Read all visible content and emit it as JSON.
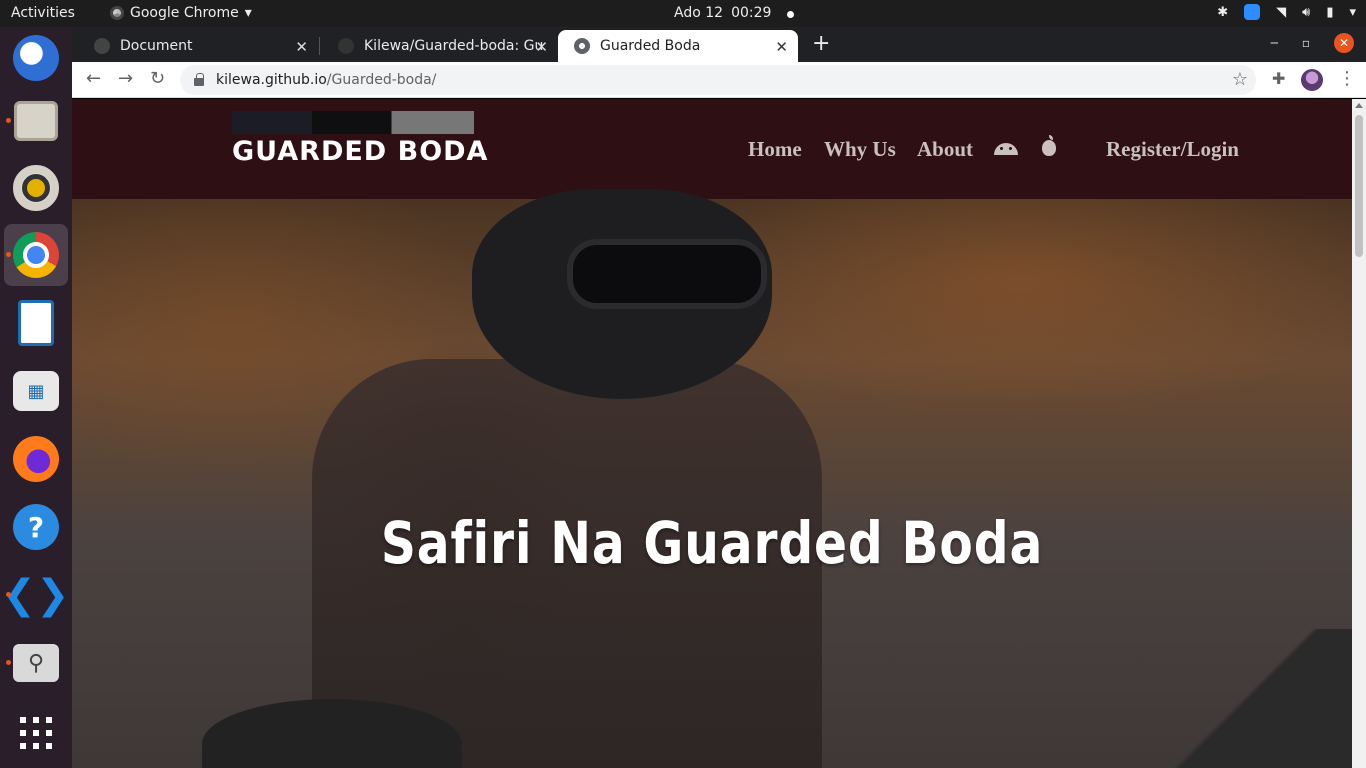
{
  "system": {
    "activities": "Activities",
    "app_name": "Google Chrome",
    "date": "Ado 12",
    "time": "00:29"
  },
  "dock": {
    "items": [
      {
        "name": "thunderbird-icon"
      },
      {
        "name": "files-icon"
      },
      {
        "name": "rhythmbox-icon"
      },
      {
        "name": "chrome-icon"
      },
      {
        "name": "libreoffice-writer-icon"
      },
      {
        "name": "software-store-icon"
      },
      {
        "name": "firefox-icon"
      },
      {
        "name": "help-icon"
      },
      {
        "name": "vscode-icon"
      },
      {
        "name": "screenshot-search-icon"
      }
    ]
  },
  "browser": {
    "tabs": [
      {
        "label": "Document"
      },
      {
        "label": "Kilewa/Guarded-boda: Gu"
      },
      {
        "label": "Guarded Boda"
      }
    ],
    "url_host": "kilewa.github.io",
    "url_path": "/Guarded-boda/"
  },
  "site": {
    "logo_text": "GUARDED BODA",
    "nav": {
      "home": "Home",
      "why_us": "Why Us",
      "about": "About",
      "register_login": "Register/Login"
    },
    "hero_title": "Safiri Na Guarded Boda"
  },
  "colors": {
    "nav_bg": "#2e0f13",
    "nav_link": "#c9c0c0",
    "accent_orange": "#e95420"
  }
}
